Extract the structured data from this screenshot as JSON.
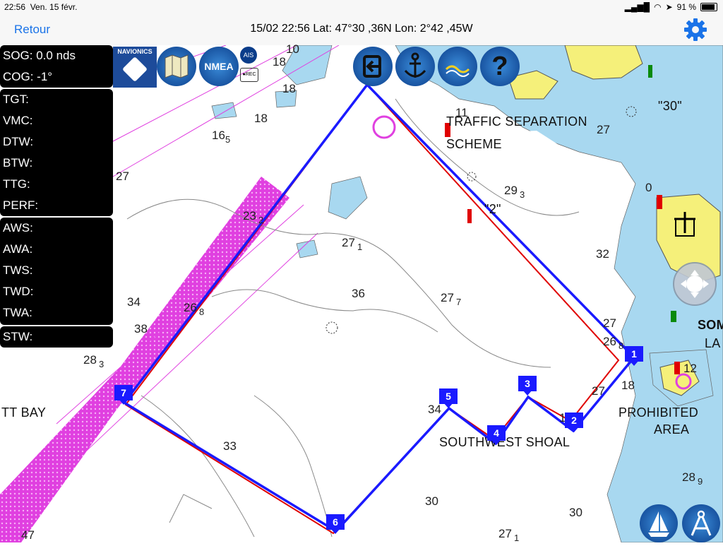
{
  "status": {
    "time": "22:56",
    "date": "Ven. 15 févr.",
    "battery": "91 %"
  },
  "nav": {
    "back_label": "Retour",
    "title": "15/02 22:56  Lat: 47°30 ,36N Lon: 2°42 ,45W"
  },
  "panels": {
    "speed": [
      {
        "label": "SOG: 0.0 nds"
      },
      {
        "label": "COG: -1°"
      }
    ],
    "target": [
      {
        "label": "TGT:"
      },
      {
        "label": "VMC:"
      },
      {
        "label": "DTW:"
      },
      {
        "label": "BTW:"
      },
      {
        "label": "TTG:"
      },
      {
        "label": "PERF:"
      }
    ],
    "wind": [
      {
        "label": "AWS:"
      },
      {
        "label": "AWA:"
      },
      {
        "label": "TWS:"
      },
      {
        "label": "TWD:"
      },
      {
        "label": "TWA:"
      }
    ],
    "water": [
      {
        "label": "STW:"
      }
    ]
  },
  "toolbar": {
    "navionics": "NAVIONICS",
    "nmea": "NMEA",
    "ais": "AIS",
    "rec": "REC",
    "help": "?"
  },
  "chart": {
    "labels": {
      "tss1": "TRAFFIC SEPARATION",
      "tss2": "SCHEME",
      "bay": "TT BAY",
      "shoal": "SOUTHWEST SHOAL",
      "prohibited1": "PROHIBITED",
      "prohibited2": "AREA",
      "quote30": "\"30\"",
      "quote2": "\"2\"",
      "som": "SOM",
      "la": "LA"
    },
    "depths": [
      "10",
      "18",
      "18",
      "18",
      "16",
      "5",
      "27",
      "11",
      "27",
      "29",
      "3",
      "0",
      "27",
      "1",
      "36",
      "27",
      "7",
      "32",
      "34",
      "38",
      "26",
      "8",
      "28",
      "3",
      "27",
      "26",
      "8",
      "27",
      "18",
      "34",
      "33",
      "30",
      "30",
      "27",
      "1",
      "28",
      "9",
      "12",
      "12",
      "23",
      "2",
      "47"
    ],
    "waypoints": [
      "1",
      "2",
      "3",
      "4",
      "5",
      "6",
      "7"
    ]
  },
  "colors": {
    "route_blue": "#1a1aff",
    "route_red": "#e00000",
    "land": "#f5f07a",
    "shallow": "#a8d8f0",
    "tss": "#e040e0"
  }
}
